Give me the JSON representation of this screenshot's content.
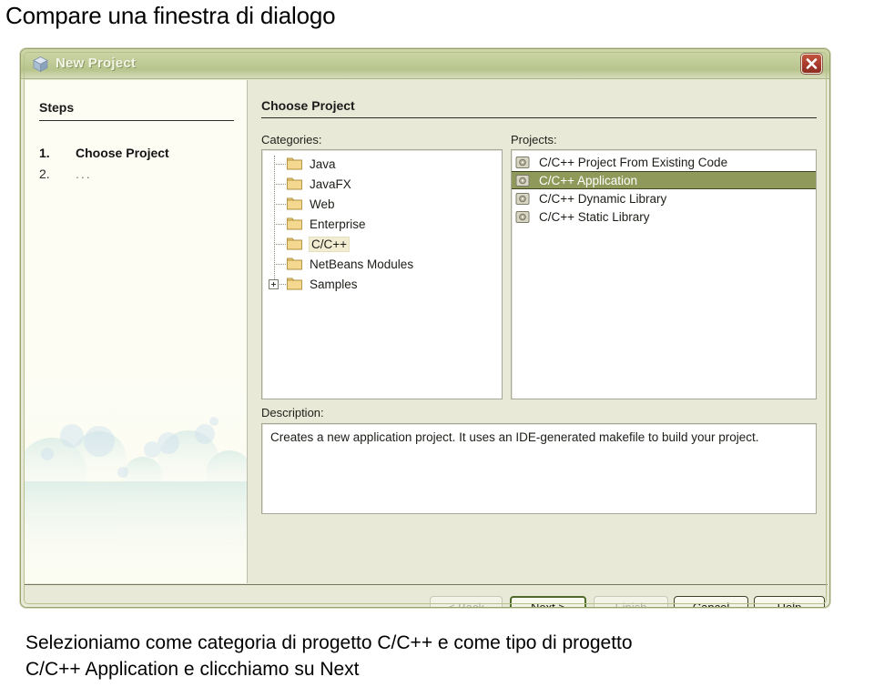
{
  "slide": {
    "heading": "Compare una finestra di dialogo",
    "caption_line1": "Selezioniamo come categoria di progetto C/C++ e come tipo di progetto",
    "caption_line2": "C/C++ Application e clicchiamo su Next"
  },
  "dialog": {
    "title": "New Project",
    "close_label": "×",
    "steps": {
      "header": "Steps",
      "items": [
        {
          "number": "1.",
          "label": "Choose Project",
          "current": true
        },
        {
          "number": "2.",
          "label": "...",
          "current": false
        }
      ]
    },
    "pane_title": "Choose Project",
    "categories": {
      "label": "Categories:",
      "items": [
        {
          "label": "Java",
          "selected": false,
          "expandable": false
        },
        {
          "label": "JavaFX",
          "selected": false,
          "expandable": false
        },
        {
          "label": "Web",
          "selected": false,
          "expandable": false
        },
        {
          "label": "Enterprise",
          "selected": false,
          "expandable": false
        },
        {
          "label": "C/C++",
          "selected": true,
          "expandable": false
        },
        {
          "label": "NetBeans Modules",
          "selected": false,
          "expandable": false
        },
        {
          "label": "Samples",
          "selected": false,
          "expandable": true
        }
      ]
    },
    "projects": {
      "label": "Projects:",
      "items": [
        {
          "label": "C/C++ Project From Existing Code",
          "selected": false
        },
        {
          "label": "C/C++ Application",
          "selected": true
        },
        {
          "label": "C/C++ Dynamic Library",
          "selected": false
        },
        {
          "label": "C/C++ Static Library",
          "selected": false
        }
      ]
    },
    "description": {
      "label": "Description:",
      "text": "Creates a new application project. It uses an IDE-generated makefile to build your project."
    },
    "buttons": [
      {
        "label": "< Back",
        "state": "disabled"
      },
      {
        "label": "Next >",
        "state": "default"
      },
      {
        "label": "Finish",
        "state": "disabled"
      },
      {
        "label": "Cancel",
        "state": "normal"
      },
      {
        "label": "Help",
        "state": "normal"
      }
    ]
  },
  "colors": {
    "titlebar_green": "#b7c48c",
    "dialog_bg": "#e9e9d8",
    "selection_olive": "#8f9a5a",
    "close_red": "#a83b2c",
    "folder_yellow": "#f0d080"
  }
}
